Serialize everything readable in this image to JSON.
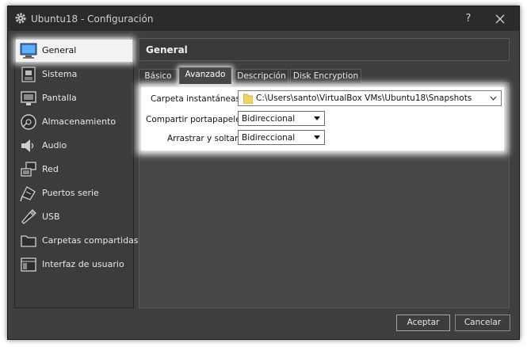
{
  "window": {
    "title": "Ubuntu18 - Configuración",
    "help_label": "?"
  },
  "sidebar": {
    "items": [
      {
        "label": "General",
        "icon": "monitor-icon",
        "selected": true
      },
      {
        "label": "Sistema",
        "icon": "chip-icon"
      },
      {
        "label": "Pantalla",
        "icon": "display-icon"
      },
      {
        "label": "Almacenamiento",
        "icon": "disk-icon"
      },
      {
        "label": "Audio",
        "icon": "speaker-icon"
      },
      {
        "label": "Red",
        "icon": "network-icon"
      },
      {
        "label": "Puertos serie",
        "icon": "serial-port-icon"
      },
      {
        "label": "USB",
        "icon": "usb-icon"
      },
      {
        "label": "Carpetas compartidas",
        "icon": "folder-icon"
      },
      {
        "label": "Interfaz de usuario",
        "icon": "window-icon"
      }
    ]
  },
  "panel": {
    "title": "General"
  },
  "tabs": [
    {
      "label": "Básico"
    },
    {
      "label": "Avanzado",
      "active": true
    },
    {
      "label": "Descripción"
    },
    {
      "label": "Disk Encryption"
    }
  ],
  "advanced": {
    "snapshot_label": "Carpeta instantáneas:",
    "snapshot_path": "C:\\Users\\santo\\VirtualBox VMs\\Ubuntu18\\Snapshots",
    "clipboard_label": "Compartir portapapeles:",
    "clipboard_value": "Bidireccional",
    "dragdrop_label": "Arrastrar y soltar:",
    "dragdrop_value": "Bidireccional"
  },
  "buttons": {
    "accept": "Aceptar",
    "cancel": "Cancelar"
  },
  "colors": {
    "window_bg": "#3f3f3f",
    "titlebar_bg": "#2b2b2b",
    "highlight": "#ffffff"
  }
}
